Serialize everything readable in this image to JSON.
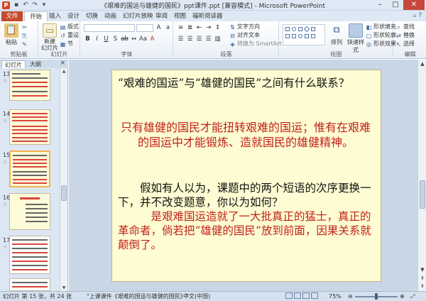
{
  "window": {
    "title": "《艰难的国运与雄健的国民》ppt课件.ppt [兼容模式] - Microsoft PowerPoint"
  },
  "tabs": [
    "文件",
    "开始",
    "插入",
    "设计",
    "切换",
    "动画",
    "幻灯片放映",
    "审阅",
    "视图",
    "福昕阅读器"
  ],
  "ribbon": {
    "paste": "粘贴",
    "cut": "剪切",
    "copy": "复制",
    "format_painter": "格式刷",
    "new_slide": "新建\n幻灯片",
    "layout": "版式",
    "reset": "重设",
    "section": "节",
    "text_direction": "文字方向",
    "align_text": "对齐文本",
    "smartart": "转换为 SmartArt",
    "arrange": "排列",
    "quick_styles": "快速样式",
    "shape_fill": "形状填充",
    "shape_outline": "形状轮廓",
    "shape_effects": "形状效果",
    "find": "查找",
    "replace": "替换",
    "select": "选择",
    "groups": {
      "clipboard": "剪贴板",
      "slides": "幻灯片",
      "font": "字体",
      "paragraph": "段落",
      "drawing": "绘图",
      "editing": "编辑"
    }
  },
  "panel": {
    "tab_slides": "幻灯片",
    "tab_outline": "大纲",
    "close": "×",
    "thumbs": [
      {
        "num": "13"
      },
      {
        "num": "14"
      },
      {
        "num": "15"
      },
      {
        "num": "16"
      },
      {
        "num": "17"
      }
    ]
  },
  "slide": {
    "question": "“艰难的国运”与“雄健的国民”之间有什么联系？",
    "answer1": "只有雄健的国民才能扭转艰难的国运；惟有在艰难的国运中才能锻炼、造就国民的雄健精神。",
    "question2": "假如有人以为，课题中的两个短语的次序更换一下，并不改变题意，你以为如何？",
    "answer2": "是艰难国运造就了一大批真正的猛士，真正的革命者，倘若把“雄健的国民“放到前面，因果关系就颠倒了。"
  },
  "status": {
    "slide_info": "幻灯片 第 15 张，共 24 张",
    "theme": "\"上课课件《艰难的国运与雄健的国民》\"",
    "language": "中文(中国)",
    "zoom": "75%"
  }
}
